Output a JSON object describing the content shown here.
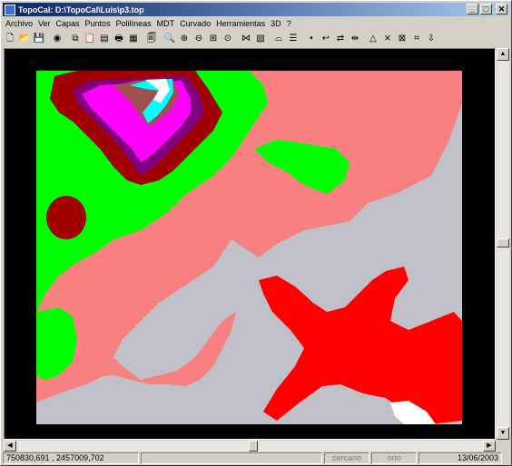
{
  "window": {
    "title": "TopoCal: D:\\TopoCal\\Luis\\p3.top",
    "controls": {
      "minimize": "_",
      "maximize": "□",
      "close": "✕"
    }
  },
  "menubar": {
    "items": [
      "Archivo",
      "Ver",
      "Capas",
      "Puntos",
      "Polilíneas",
      "MDT",
      "Curvado",
      "Herramientas",
      "3D",
      "?"
    ]
  },
  "toolbar": {
    "icons": [
      {
        "name": "new-file-icon",
        "glyph": "🗋"
      },
      {
        "name": "open-folder-icon",
        "glyph": "📂"
      },
      {
        "name": "save-disk-icon",
        "glyph": "💾"
      },
      {
        "name": "colors-icon",
        "glyph": "◉"
      },
      {
        "name": "copy-icon",
        "glyph": "⧉"
      },
      {
        "name": "paste-icon",
        "glyph": "📋"
      },
      {
        "name": "layers-icon",
        "glyph": "▤"
      },
      {
        "name": "print-icon",
        "glyph": "🖶"
      },
      {
        "name": "select-icon",
        "glyph": "▦"
      },
      {
        "name": "print-preview-icon",
        "glyph": "🗐"
      },
      {
        "name": "zoom-window-icon",
        "glyph": "🔍"
      },
      {
        "name": "zoom-in-icon",
        "glyph": "⊕"
      },
      {
        "name": "zoom-out-icon",
        "glyph": "⊖"
      },
      {
        "name": "zoom-all-icon",
        "glyph": "⊞"
      },
      {
        "name": "zoom-previous-icon",
        "glyph": "⊙"
      },
      {
        "name": "triangulate-icon",
        "glyph": "⋈"
      },
      {
        "name": "surface-icon",
        "glyph": "▧"
      },
      {
        "name": "profile-icon",
        "glyph": "⌓"
      },
      {
        "name": "sections-icon",
        "glyph": "☰"
      },
      {
        "name": "point-icon",
        "glyph": "•"
      },
      {
        "name": "polyline-icon",
        "glyph": "↩"
      },
      {
        "name": "move-icon",
        "glyph": "⇄"
      },
      {
        "name": "stretch-icon",
        "glyph": "⇹"
      },
      {
        "name": "triangle-icon",
        "glyph": "△"
      },
      {
        "name": "delete-triangle-icon",
        "glyph": "⨯"
      },
      {
        "name": "mesh-icon",
        "glyph": "⊠"
      },
      {
        "name": "grid-icon",
        "glyph": "⌗"
      },
      {
        "name": "download-icon",
        "glyph": "⇩"
      }
    ]
  },
  "status": {
    "coordinates": "750830,691 , 2457009,702",
    "snap": "cercano",
    "ortho": "orto",
    "date": "13/06/2003"
  },
  "map_colors": {
    "background": "#000000",
    "salmon": "#f88080",
    "gray": "#c0c0c8",
    "green": "#00ff00",
    "red": "#ff0000",
    "dark_red": "#a00000",
    "magenta": "#ff00ff",
    "purple": "#800080",
    "cyan": "#00ffff",
    "brown": "#a05050",
    "white": "#ffffff"
  }
}
